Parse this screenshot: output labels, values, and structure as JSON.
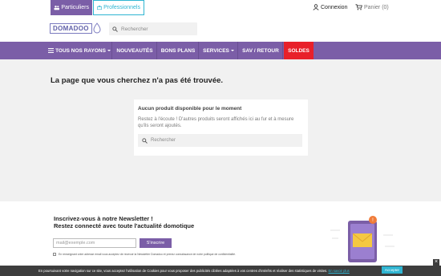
{
  "topbar": {
    "particuliers_label": "Particuliers",
    "professionnels_label": "Professionnels",
    "connexion_label": "Connexion",
    "panier_label": "Panier",
    "panier_count": "(0)"
  },
  "header": {
    "logo_text": "DOMADOO",
    "search_placeholder": "Rechercher"
  },
  "nav": {
    "items": [
      {
        "label": "TOUS NOS RAYONS"
      },
      {
        "label": "NOUVEAUTÉS"
      },
      {
        "label": "BONS PLANS"
      },
      {
        "label": "SERVICES"
      },
      {
        "label": "SAV / RETOUR"
      },
      {
        "label": "SOLDES"
      }
    ]
  },
  "main": {
    "title": "La page que vous cherchez n'a pas été trouvée.",
    "card_title": "Aucun produit disponible pour le moment",
    "card_text": "Restez à l'écoute ! D'autres produits seront affichés ici au fur et à mesure qu'ils seront ajoutés.",
    "card_search_placeholder": "Rechercher"
  },
  "newsletter": {
    "title_line1": "Inscrivez-vous à notre Newsletter !",
    "title_line2": "Restez connecté avec toute l'actualité domotique",
    "email_placeholder": "mail@exemple.com",
    "button_label": "S'inscrire",
    "legal_text": "En renseignant votre adresse email vous acceptez de recevoir la Newsletter Domadoo et prenez connaissance de notre politique de confidentialité."
  },
  "cookie": {
    "text": "En poursuivant votre navigation sur ce site, vous acceptez l'utilisation de Cookies pour vous proposer des publicités ciblées adaptées à vos centres d'intérêts et réaliser des statistiques de visites.",
    "more_label": "En savoir plus",
    "accept_label": "Accepter",
    "close_label": "×"
  },
  "colors": {
    "brand_purple": "#7b5ea7",
    "soldes_red": "#e8202a",
    "accent_cyan": "#2fb5d2"
  }
}
